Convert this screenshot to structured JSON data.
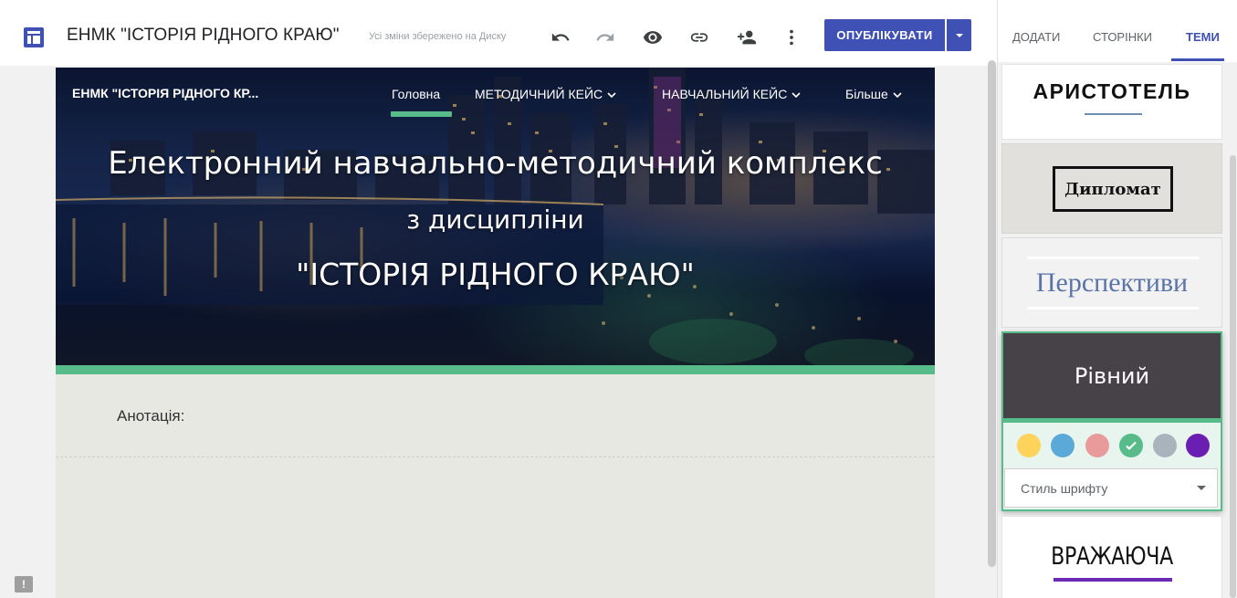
{
  "header": {
    "title": "ЕНМК \"ІСТОРІЯ РІДНОГО КРАЮ\"",
    "save_status": "Усі зміни збережено на Диску",
    "publish_label": "ОПУБЛІКУВАТИ",
    "icons": [
      "sites-logo-icon",
      "undo-icon",
      "redo-icon",
      "preview-eye-icon",
      "link-icon",
      "share-person-add-icon",
      "more-vertical-icon",
      "dropdown-arrow-icon"
    ]
  },
  "site": {
    "name": "ЕНМК \"ІСТОРІЯ РІДНОГО КР...",
    "nav": [
      {
        "label": "Головна",
        "active": true
      },
      {
        "label": "МЕТОДИЧНИЙ КЕЙС",
        "dropdown": true
      },
      {
        "label": "НАВЧАЛЬНИЙ КЕЙС",
        "dropdown": true
      },
      {
        "label": "Більше",
        "dropdown": true
      }
    ],
    "hero": {
      "line1": "Електронний навчально-методичний комплекс",
      "line2": "з дисципліни",
      "line3": "\"ІСТОРІЯ РІДНОГО КРАЮ\""
    },
    "annotation_label": "Анотація:",
    "accent_color": "#57bb8a"
  },
  "panel": {
    "tabs": [
      {
        "label": "ДОДАТИ",
        "active": false
      },
      {
        "label": "СТОРІНКИ",
        "active": false
      },
      {
        "label": "ТЕМИ",
        "active": true
      }
    ],
    "themes": {
      "aristotel": "АРИСТОТЕЛЬ",
      "diplomat": "Дипломат",
      "perspektyvy": "Перспективи",
      "rivnyi": "Рівний",
      "vrazhaiucha": "ВРАЖАЮЧА"
    },
    "swatches": [
      {
        "color": "#fdd35b",
        "selected": false
      },
      {
        "color": "#5aa9d8",
        "selected": false
      },
      {
        "color": "#e99a9a",
        "selected": false
      },
      {
        "color": "#57bb8a",
        "selected": true
      },
      {
        "color": "#a9b3bb",
        "selected": false
      },
      {
        "color": "#6a1fb2",
        "selected": false
      }
    ],
    "font_style_label": "Стиль шрифту"
  },
  "colors": {
    "primary": "#3f51b5",
    "theme_dark": "#474148",
    "vrazhaiucha_accent": "#6a2bb5"
  }
}
